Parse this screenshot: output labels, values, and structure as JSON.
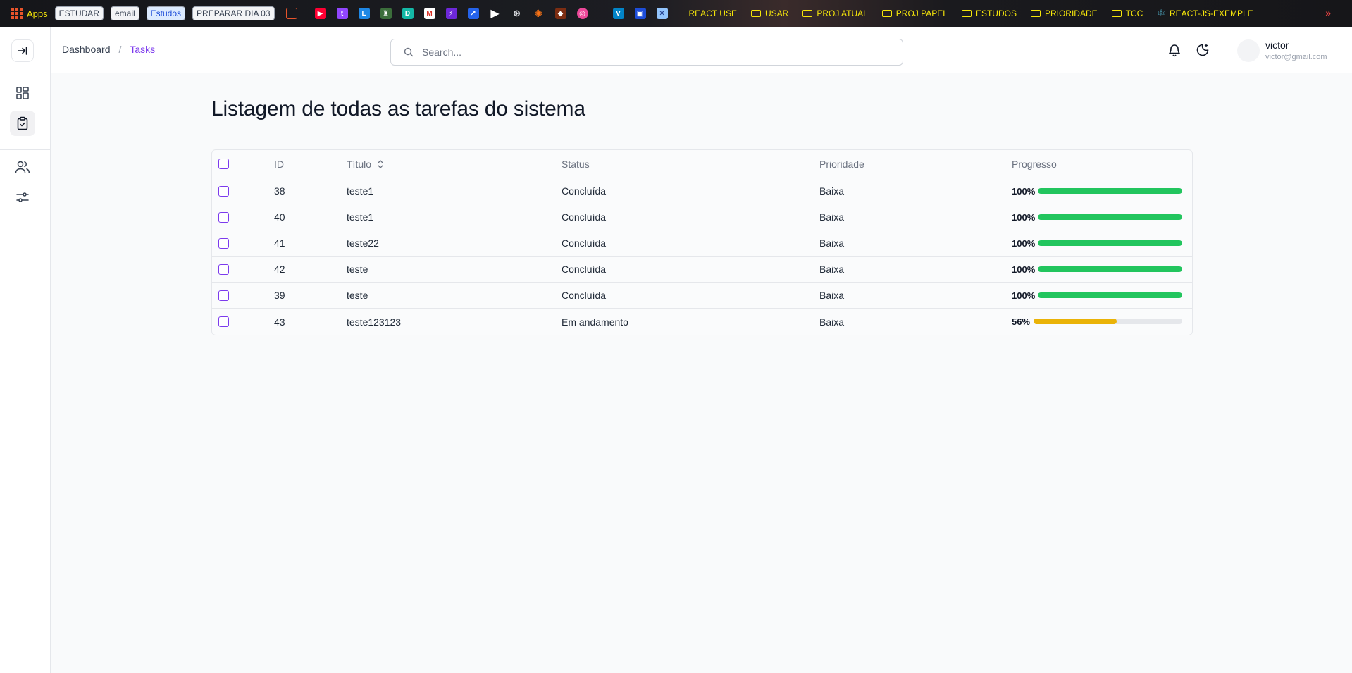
{
  "bookmarks": {
    "apps_label": "Apps",
    "pills": [
      "ESTUDAR",
      "email",
      "Estudos",
      "PREPARAR DIA 03"
    ],
    "folders": [
      "REACT USE",
      "USAR",
      "PROJ ATUAL",
      "PROJ PAPEL",
      "ESTUDOS",
      "PRIORIDADE",
      "TCC",
      "REACT-JS-EXEMPLE"
    ],
    "more": "»",
    "text_color": "#f5e50a"
  },
  "breadcrumb": {
    "home": "Dashboard",
    "separator": "/",
    "current": "Tasks"
  },
  "search": {
    "placeholder": "Search..."
  },
  "user": {
    "name": "victor",
    "email": "victor@gmail.com"
  },
  "page": {
    "title": "Listagem de todas as tarefas do sistema"
  },
  "table": {
    "columns": {
      "id": "ID",
      "title": "Título",
      "status": "Status",
      "priority": "Prioridade",
      "progress": "Progresso"
    },
    "rows": [
      {
        "id": "38",
        "title": "teste1",
        "status": "Concluída",
        "priority": "Baixa",
        "progress_label": "100%",
        "progress": 100
      },
      {
        "id": "40",
        "title": "teste1",
        "status": "Concluída",
        "priority": "Baixa",
        "progress_label": "100%",
        "progress": 100
      },
      {
        "id": "41",
        "title": "teste22",
        "status": "Concluída",
        "priority": "Baixa",
        "progress_label": "100%",
        "progress": 100
      },
      {
        "id": "42",
        "title": "teste",
        "status": "Concluída",
        "priority": "Baixa",
        "progress_label": "100%",
        "progress": 100
      },
      {
        "id": "39",
        "title": "teste",
        "status": "Concluída",
        "priority": "Baixa",
        "progress_label": "100%",
        "progress": 100
      },
      {
        "id": "43",
        "title": "teste123123",
        "status": "Em andamento",
        "priority": "Baixa",
        "progress_label": "56%",
        "progress": 56
      }
    ]
  },
  "colors": {
    "accent": "#7c3aed",
    "progress_complete": "#22c55e",
    "progress_partial": "#eab308",
    "progress_track": "#e5e7eb"
  },
  "icons": {
    "sidebar": [
      "sidebar-expand-icon",
      "dashboard-icon",
      "tasks-clipboard-icon",
      "users-icon",
      "settings-sliders-icon"
    ],
    "header": [
      "search-icon",
      "bell-icon",
      "theme-moon-icon"
    ]
  }
}
